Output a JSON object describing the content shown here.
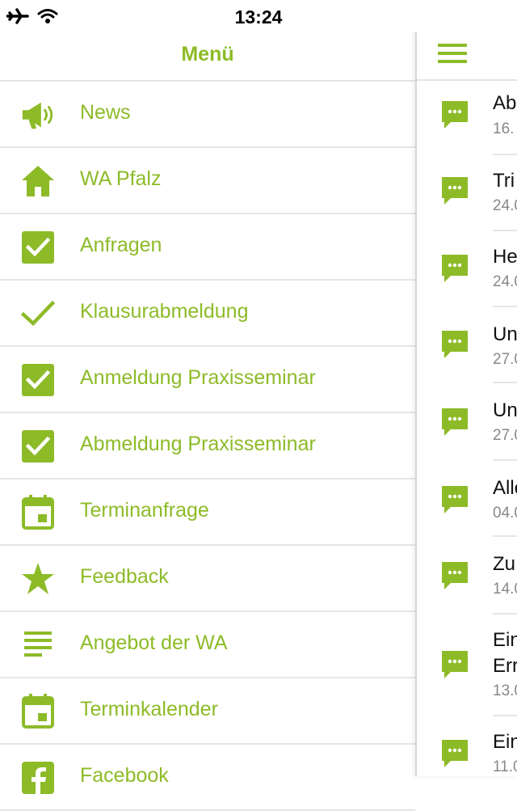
{
  "status_bar": {
    "time": "13:24"
  },
  "menu": {
    "title": "Menü",
    "items": [
      {
        "label": "News",
        "icon": "megaphone-icon"
      },
      {
        "label": "WA Pfalz",
        "icon": "home-icon"
      },
      {
        "label": "Anfragen",
        "icon": "checkbox-icon"
      },
      {
        "label": "Klausurabmeldung",
        "icon": "checkmark-icon"
      },
      {
        "label": "Anmeldung Praxisseminar",
        "icon": "checkbox-icon"
      },
      {
        "label": "Abmeldung Praxisseminar",
        "icon": "checkbox-icon"
      },
      {
        "label": "Terminanfrage",
        "icon": "calendar-icon"
      },
      {
        "label": "Feedback",
        "icon": "star-icon"
      },
      {
        "label": "Angebot der WA",
        "icon": "list-icon"
      },
      {
        "label": "Terminkalender",
        "icon": "calendar-icon"
      },
      {
        "label": "Facebook",
        "icon": "facebook-icon"
      }
    ]
  },
  "news": {
    "items": [
      {
        "title": "Ab",
        "date": "16."
      },
      {
        "title": "Tri",
        "date": "24.0"
      },
      {
        "title": "He",
        "date": "24.0"
      },
      {
        "title": "Un",
        "date": "27.0"
      },
      {
        "title": "Un",
        "date": "27.0"
      },
      {
        "title": "Alle",
        "date": "04.0"
      },
      {
        "title": "Zu",
        "date": "14.0"
      },
      {
        "title": "Ein",
        "title2": "Err",
        "date": "13.0"
      },
      {
        "title": "Ein",
        "date": "11.0"
      }
    ]
  },
  "colors": {
    "accent": "#8dbb28"
  }
}
